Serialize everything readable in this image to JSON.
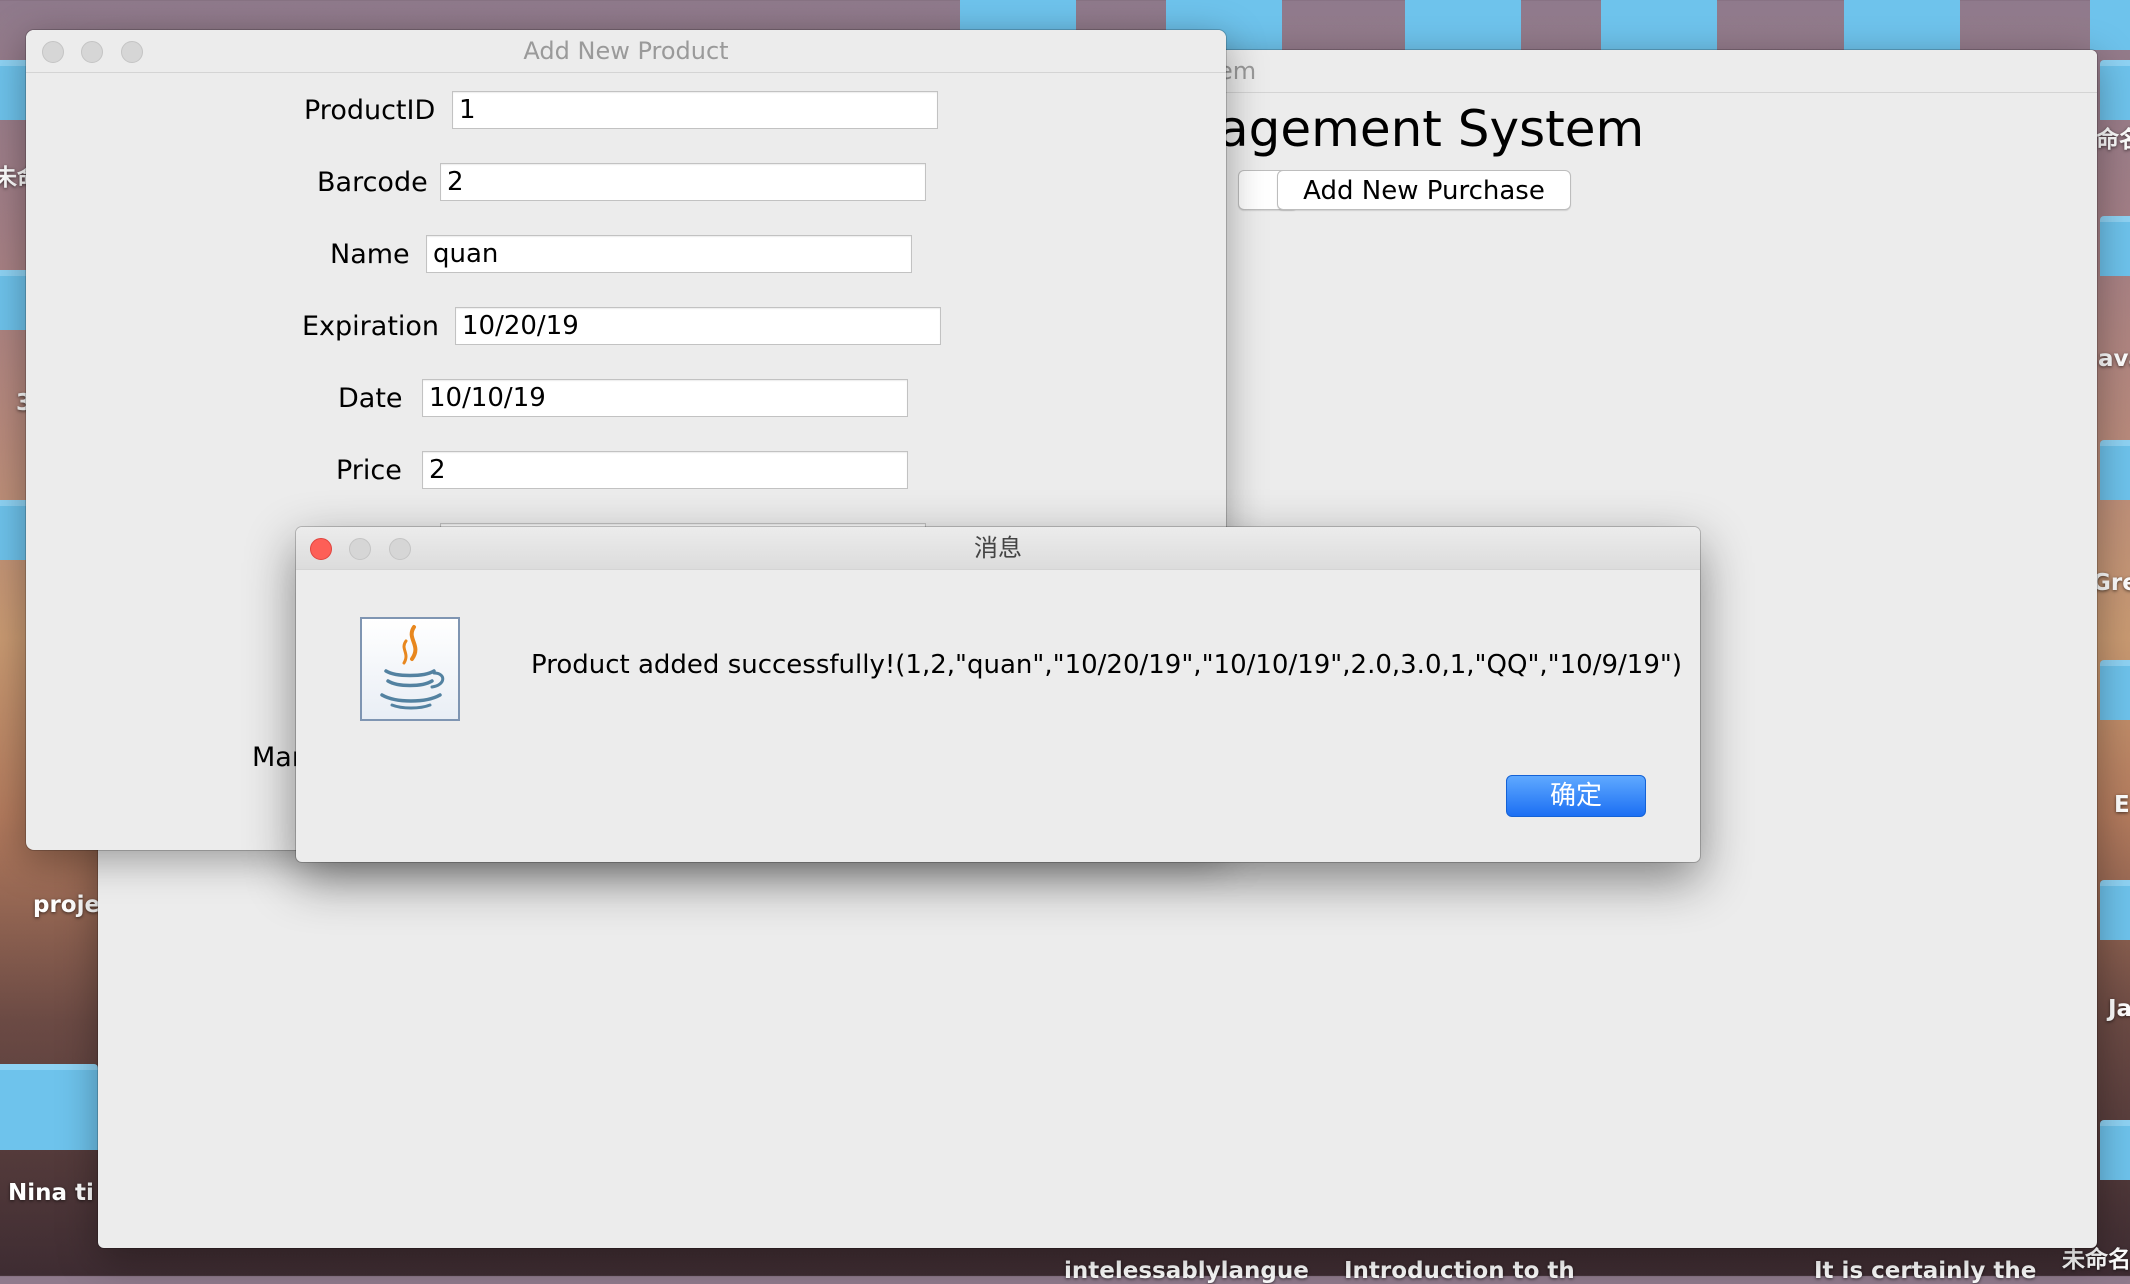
{
  "desktop": {
    "labels": [
      "未命",
      "命名",
      "3",
      "ava",
      "Gre",
      "E",
      "Ja",
      "proje",
      "Nina ti",
      "intelessablylangue",
      "Introduction to th",
      "It is certainly the",
      "未命名"
    ]
  },
  "main_window": {
    "title": "em",
    "heading": "agement System",
    "buttons": {
      "add_new_purchase": "Add New Purchase"
    }
  },
  "product_window": {
    "title": "Add New Product",
    "fields": [
      {
        "label": "ProductID",
        "value": "1"
      },
      {
        "label": "Barcode",
        "value": "2"
      },
      {
        "label": "Name",
        "value": "quan"
      },
      {
        "label": "Expiration",
        "value": "10/20/19"
      },
      {
        "label": "Date",
        "value": "10/10/19"
      },
      {
        "label": "Price",
        "value": "2"
      }
    ],
    "partial_label": "Mar"
  },
  "message_dialog": {
    "title": "消息",
    "icon": "java-coffee-cup-icon",
    "message": "Product added successfully!(1,2,\"quan\",\"10/20/19\",\"10/10/19\",2.0,3.0,1,\"QQ\",\"10/9/19\")",
    "ok_label": "确定"
  },
  "colors": {
    "ok_button": "#1c6ff3",
    "close_button": "#fd5f57",
    "window_bg": "#ececec",
    "folder": "#6ec3ec"
  }
}
